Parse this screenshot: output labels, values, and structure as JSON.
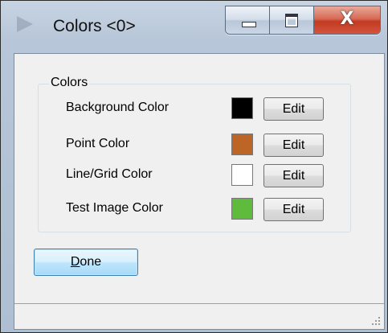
{
  "window": {
    "title": "Colors <0>",
    "caption_buttons": [
      "minimize",
      "maximize",
      "close"
    ],
    "close_glyph": "X"
  },
  "group": {
    "title": "Colors",
    "rows": [
      {
        "label": "Background Color",
        "swatch": "#000000",
        "button": "Edit"
      },
      {
        "label": "Point Color",
        "swatch": "#bd6427",
        "button": "Edit"
      },
      {
        "label": "Line/Grid Color",
        "swatch": "#ffffff",
        "button": "Edit"
      },
      {
        "label": "Test Image Color",
        "swatch": "#5fbb3c",
        "button": "Edit"
      }
    ]
  },
  "done_button": {
    "mnemonic": "D",
    "rest": "one"
  },
  "icons": {
    "app": "app-icon",
    "minimize": "minimize-icon",
    "maximize": "maximize-icon",
    "close": "close-icon",
    "grip": "resize-grip-icon"
  },
  "colors": {
    "close_button": "#c23a22",
    "done_border": "#3c7fb1"
  }
}
